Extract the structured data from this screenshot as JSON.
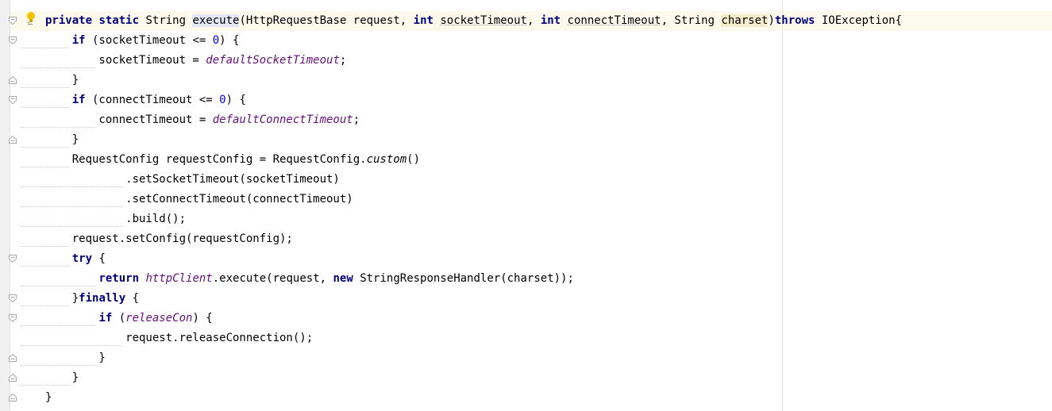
{
  "editor": {
    "lines": [
      [
        [
          "kw",
          "private"
        ],
        [
          "t",
          " "
        ],
        [
          "kw",
          "static"
        ],
        [
          "t",
          " String "
        ],
        [
          "hm",
          "execute"
        ],
        [
          "t",
          "(HttpRequestBase request, "
        ],
        [
          "kw",
          "int"
        ],
        [
          "t",
          " "
        ],
        [
          "u",
          "socketTimeout"
        ],
        [
          "t",
          ", "
        ],
        [
          "kw",
          "int"
        ],
        [
          "t",
          " "
        ],
        [
          "u",
          "connectTimeout"
        ],
        [
          "t",
          ", String "
        ],
        [
          "hp",
          "charset"
        ],
        [
          "t",
          ")"
        ],
        [
          "kw",
          "throws"
        ],
        [
          "t",
          " IOException{"
        ]
      ],
      [
        [
          "t",
          "    "
        ],
        [
          "kw",
          "if"
        ],
        [
          "t",
          " (socketTimeout <= "
        ],
        [
          "num",
          "0"
        ],
        [
          "t",
          ") {"
        ]
      ],
      [
        [
          "t",
          "        socketTimeout = "
        ],
        [
          "field",
          "defaultSocketTimeout"
        ],
        [
          "t",
          ";"
        ]
      ],
      [
        [
          "t",
          "    }"
        ]
      ],
      [
        [
          "t",
          "    "
        ],
        [
          "kw",
          "if"
        ],
        [
          "t",
          " (connectTimeout <= "
        ],
        [
          "num",
          "0"
        ],
        [
          "t",
          ") {"
        ]
      ],
      [
        [
          "t",
          "        connectTimeout = "
        ],
        [
          "field",
          "defaultConnectTimeout"
        ],
        [
          "t",
          ";"
        ]
      ],
      [
        [
          "t",
          "    }"
        ]
      ],
      [
        [
          "t",
          "    RequestConfig requestConfig = RequestConfig."
        ],
        [
          "static",
          "custom"
        ],
        [
          "t",
          "()"
        ]
      ],
      [
        [
          "t",
          "            .setSocketTimeout(socketTimeout)"
        ]
      ],
      [
        [
          "t",
          "            .setConnectTimeout(connectTimeout)"
        ]
      ],
      [
        [
          "t",
          "            .build();"
        ]
      ],
      [
        [
          "t",
          "    request.setConfig(requestConfig);"
        ]
      ],
      [
        [
          "t",
          "    "
        ],
        [
          "kw",
          "try"
        ],
        [
          "t",
          " {"
        ]
      ],
      [
        [
          "t",
          "        "
        ],
        [
          "kw",
          "return"
        ],
        [
          "t",
          " "
        ],
        [
          "field",
          "httpClient"
        ],
        [
          "t",
          ".execute(request, "
        ],
        [
          "kw",
          "new"
        ],
        [
          "t",
          " StringResponseHandler(charset));"
        ]
      ],
      [
        [
          "t",
          "    }"
        ],
        [
          "kw",
          "finally"
        ],
        [
          "t",
          " {"
        ]
      ],
      [
        [
          "t",
          "        "
        ],
        [
          "kw",
          "if"
        ],
        [
          "t",
          " ("
        ],
        [
          "field",
          "releaseCon"
        ],
        [
          "t",
          ") {"
        ]
      ],
      [
        [
          "t",
          "            request.releaseConnection();"
        ]
      ],
      [
        [
          "t",
          "        }"
        ]
      ],
      [
        [
          "t",
          "    }"
        ]
      ],
      [
        [
          "t",
          "}"
        ]
      ]
    ]
  },
  "gutter": {
    "fold_icons": [
      "fold-open",
      "fold-open",
      "",
      "fold-close",
      "fold-open",
      "",
      "fold-close",
      "",
      "",
      "",
      "",
      "",
      "fold-open",
      "",
      "fold-open",
      "fold-open",
      "",
      "fold-close",
      "fold-close",
      "fold-close"
    ],
    "intention_icon": "lightbulb-icon"
  },
  "colors": {
    "keyword": "#000080",
    "number": "#0000ff",
    "field": "#660e7a",
    "current_line": "#fcfaed",
    "method_highlight": "#e6e6f6",
    "param_highlight": "#f5eccb"
  }
}
